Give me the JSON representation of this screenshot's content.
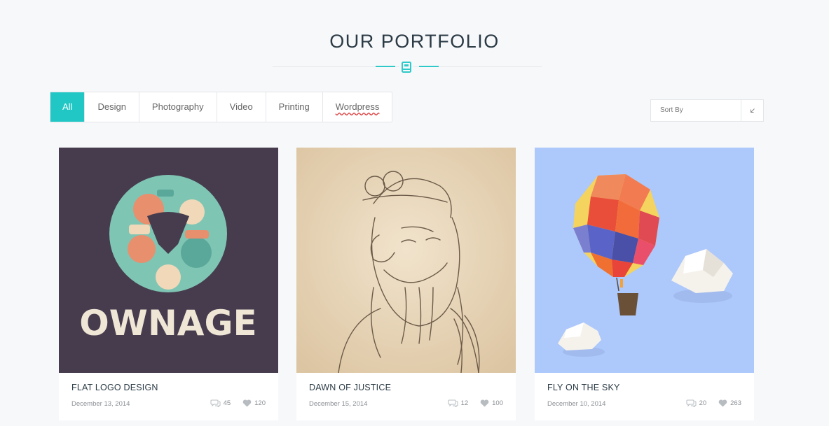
{
  "header": {
    "title": "OUR PORTFOLIO",
    "accent": "#2ec9c9"
  },
  "filters": [
    {
      "label": "All",
      "active": true
    },
    {
      "label": "Design"
    },
    {
      "label": "Photography"
    },
    {
      "label": "Video"
    },
    {
      "label": "Printing"
    },
    {
      "label": "Wordpress"
    }
  ],
  "sort": {
    "label": "Sort By"
  },
  "cards": [
    {
      "title": "FLAT LOGO DESIGN",
      "date": "December 13, 2014",
      "comments": "45",
      "likes": "120",
      "logo_text": "OWNAGE"
    },
    {
      "title": "DAWN OF JUSTICE",
      "date": "December 15, 2014",
      "comments": "12",
      "likes": "100"
    },
    {
      "title": "FLY ON THE SKY",
      "date": "December 10, 2014",
      "comments": "20",
      "likes": "263"
    }
  ]
}
